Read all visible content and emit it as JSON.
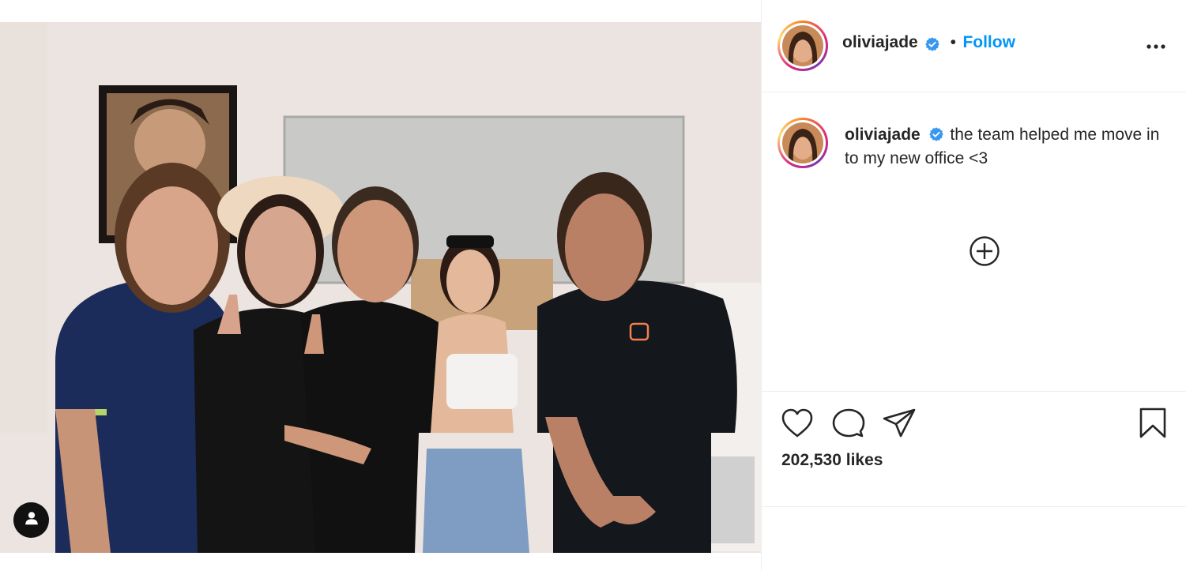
{
  "post": {
    "username": "oliviajade",
    "follow_label": "Follow",
    "separator": "•",
    "caption_username": "oliviajade",
    "caption_text": "the team helped me move in to my new office <3",
    "likes": "202,530 likes"
  },
  "icons": {
    "more": "more-options-icon",
    "verified": "verified-badge-icon",
    "add": "add-circle-icon",
    "like": "heart-icon",
    "comment": "comment-icon",
    "share": "share-icon",
    "save": "bookmark-icon",
    "user_tag": "user-tag-icon"
  },
  "colors": {
    "link": "#0095f6",
    "verified": "#3897f0",
    "text": "#262626",
    "border": "#efefef"
  }
}
